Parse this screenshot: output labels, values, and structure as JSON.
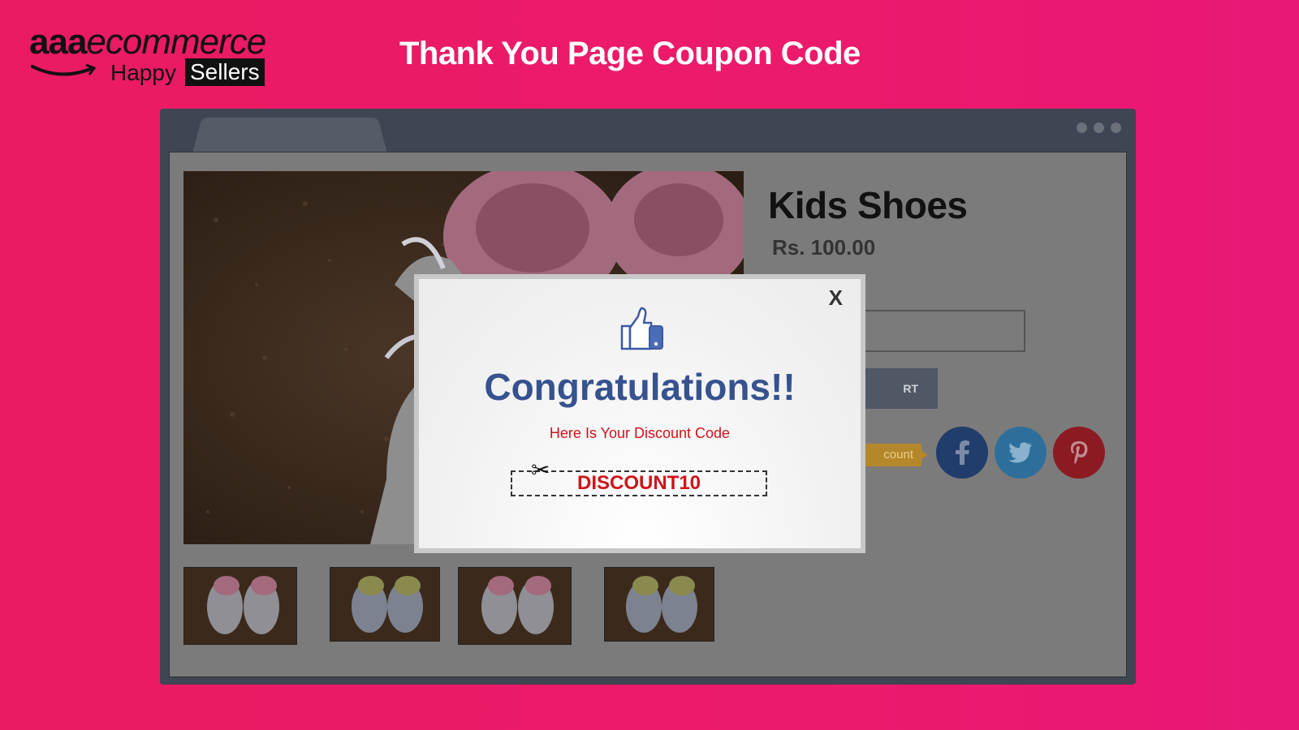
{
  "branding": {
    "logo_brand_bold": "aaa",
    "logo_brand_italic": "ecommerce",
    "logo_tagline_word": "Happy",
    "logo_tagline_badge": "Sellers",
    "banner_title": "Thank You Page Coupon Code"
  },
  "product": {
    "name": "Kids Shoes",
    "price": "Rs. 100.00",
    "cart_button_partial": "RT",
    "discount_tag_partial": "count"
  },
  "social": {
    "icons": [
      "facebook-icon",
      "twitter-icon",
      "pinterest-icon"
    ],
    "colors": {
      "facebook": "#213d6b",
      "twitter": "#2d6f9a",
      "pinterest": "#8c1a22"
    }
  },
  "modal": {
    "close_label": "X",
    "heading": "Congratulations!!",
    "subline": "Here Is Your Discount Code",
    "coupon_code": "DISCOUNT10",
    "scissors_glyph": "✂",
    "icon": "thumbs-up-icon"
  },
  "colors": {
    "background": "#eb1a68",
    "heading_blue": "#36528f",
    "coupon_red": "#d0121b"
  }
}
